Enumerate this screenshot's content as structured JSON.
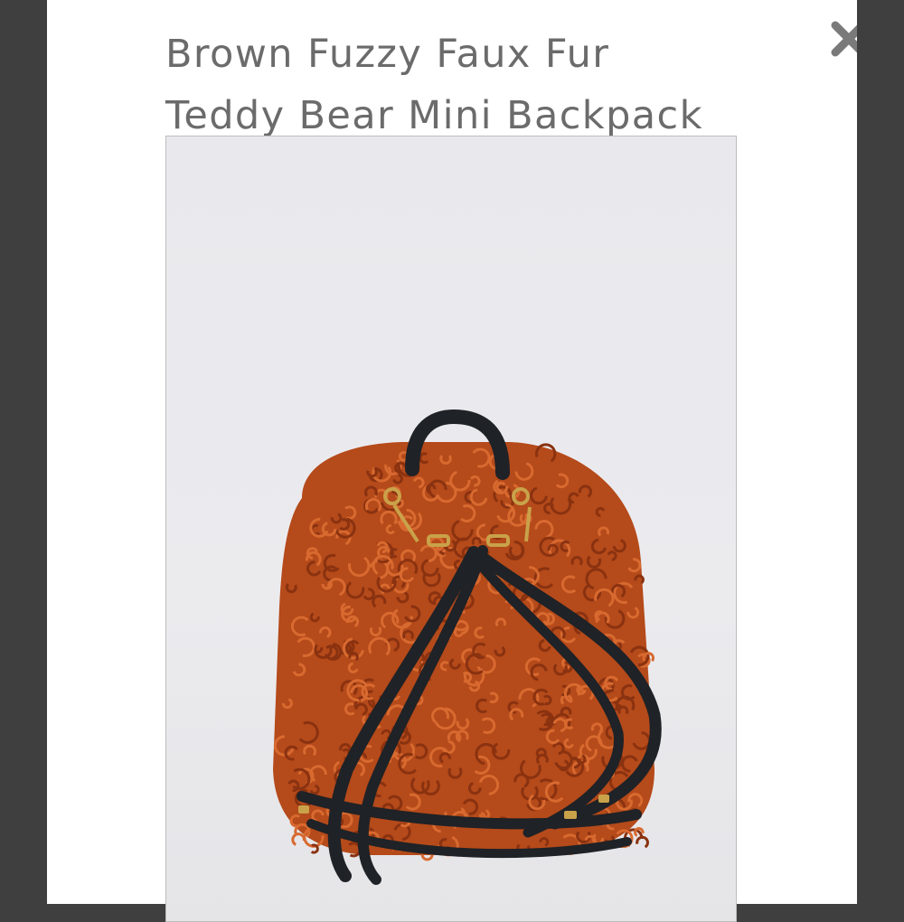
{
  "modal": {
    "title": "Brown Fuzzy Faux Fur\nTeddy Bear Mini Backpack",
    "close_icon": "close-icon"
  },
  "product_image": {
    "subject": "backpack-photo",
    "colors": {
      "fur": "#b54a1a",
      "fur_dark": "#8a3210",
      "fur_light": "#d86a30",
      "strap": "#1f2226",
      "hardware": "#c9a24a",
      "background": "#e9e9ed"
    }
  }
}
